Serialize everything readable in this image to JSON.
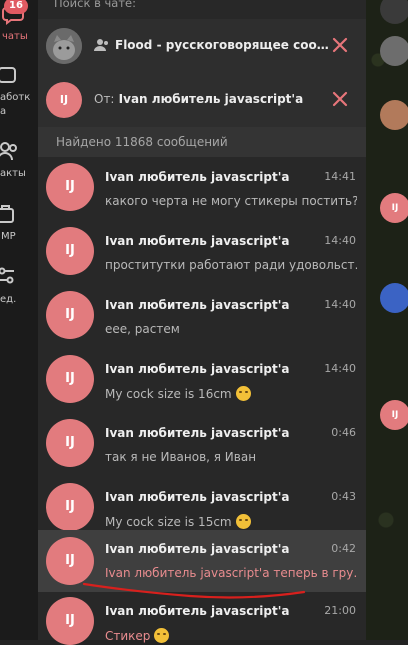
{
  "folders": {
    "badge_count": "16",
    "items": [
      {
        "label": "чаты"
      },
      {
        "label": "аботк\nа"
      },
      {
        "label": "акты"
      },
      {
        "label": "MP"
      },
      {
        "label": "ед."
      }
    ]
  },
  "search": {
    "label": "Поиск в чате:",
    "chat_filter": "Flood - русскоговорящее соо…",
    "from_prefix": "От:",
    "from_name": "Ivan любитель javascript'a",
    "found": "Найдено 11868 сообщений"
  },
  "avatar_initials": "IJ",
  "results": [
    {
      "name": "Ivan любитель javascript'a",
      "time": "14:41",
      "text": "какого черта не могу стикеры постить?"
    },
    {
      "name": "Ivan любитель javascript'a",
      "time": "14:40",
      "text": "проститутки работают ради удовольст…"
    },
    {
      "name": "Ivan любитель javascript'a",
      "time": "14:40",
      "text": "еее, растем"
    },
    {
      "name": "Ivan любитель javascript'a",
      "time": "14:40",
      "text": "My cock size is 16cm"
    },
    {
      "name": "Ivan любитель javascript'a",
      "time": "0:46",
      "text": "так я не Иванов, я Иван"
    },
    {
      "name": "Ivan любитель javascript'a",
      "time": "0:43",
      "text": "My cock size is 15cm"
    },
    {
      "name": "Ivan любитель javascript'a",
      "time": "0:42",
      "text": "Ivan любитель javascript'a теперь в гру…"
    },
    {
      "name": "Ivan любитель javascript'a",
      "time": "21:00",
      "text": "Стикер"
    }
  ],
  "colors": {
    "accent": "#e27b7e",
    "underline": "#d8201d"
  }
}
